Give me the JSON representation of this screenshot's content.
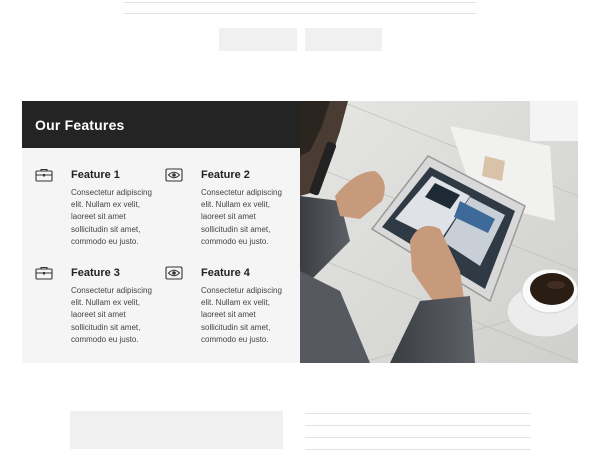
{
  "features": {
    "heading": "Our Features",
    "items": [
      {
        "title": "Feature 1",
        "icon": "briefcase-icon",
        "text": "Consectetur adipiscing\nelit. Nullam ex velit,\nlaoreet sit amet\nsollicitudin sit amet,\ncommodo eu justo."
      },
      {
        "title": "Feature 2",
        "icon": "eye-icon",
        "text": "Consectetur adipiscing\nelit. Nullam ex velit,\nlaoreet sit amet\nsollicitudin sit amet,\ncommodo eu justo."
      },
      {
        "title": "Feature 3",
        "icon": "briefcase-icon",
        "text": "Consectetur adipiscing\nelit. Nullam ex velit,\nlaoreet sit amet\nsollicitudin sit amet,\ncommodo eu justo."
      },
      {
        "title": "Feature 4",
        "icon": "eye-icon",
        "text": "Consectetur adipiscing\nelit. Nullam ex velit,\nlaoreet sit amet\nsollicitudin sit amet,\ncommodo eu justo."
      }
    ]
  },
  "colors": {
    "header_bg": "#242424",
    "panel_bg": "#f5f5f5",
    "placeholder": "#f0f0f0"
  }
}
